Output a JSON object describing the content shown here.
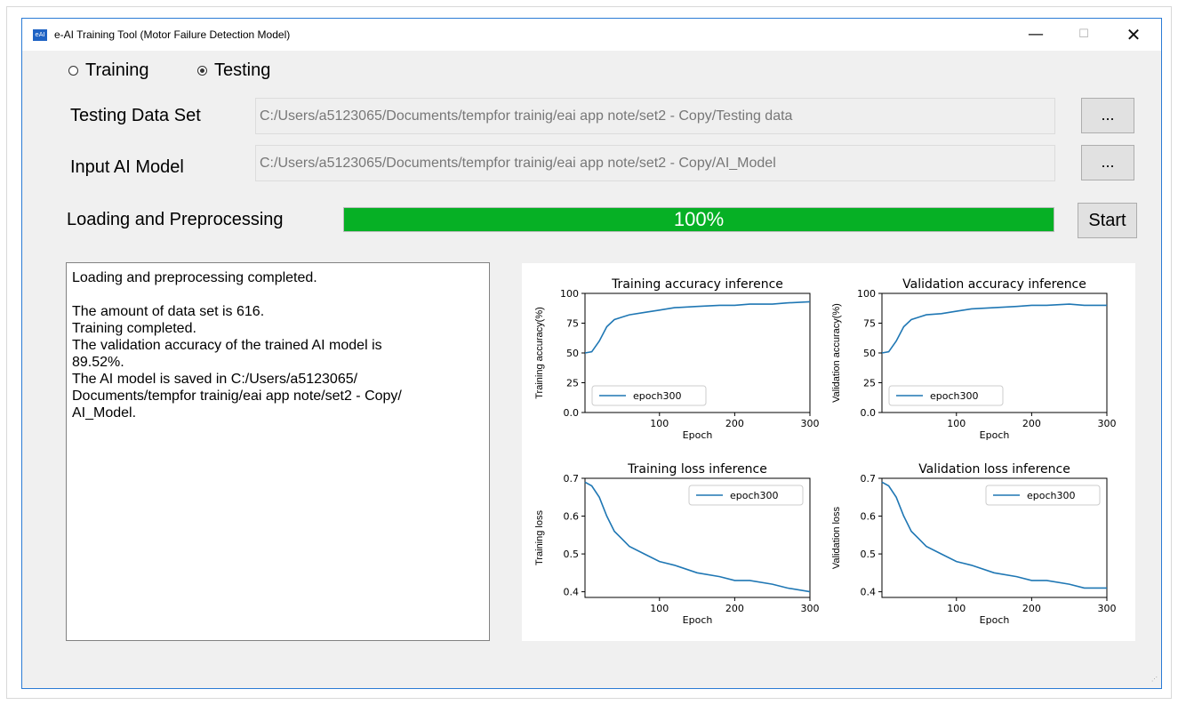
{
  "window": {
    "title": "e-AI Training Tool (Motor Failure Detection Model)",
    "icon_text": "eAI",
    "controls": {
      "minimize": "—",
      "maximize": "☐",
      "close": "✕"
    }
  },
  "mode": {
    "options": [
      {
        "label": "Training",
        "selected": false
      },
      {
        "label": "Testing",
        "selected": true
      }
    ]
  },
  "form": {
    "testing_data_label": "Testing Data Set",
    "testing_data_path": "C:/Users/a5123065/Documents/tempfor trainig/eai app note/set2 - Copy/Testing data",
    "input_model_label": "Input AI Model",
    "input_model_path": "C:/Users/a5123065/Documents/tempfor trainig/eai app note/set2 - Copy/AI_Model",
    "browse_label": "...",
    "progress_label": "Loading and Preprocessing",
    "progress_text": "100%",
    "progress_value": 1.0,
    "start_label": "Start"
  },
  "log": {
    "lines": [
      "Loading and preprocessing completed.",
      "",
      "The amount of data set is 616.",
      "Training completed.",
      "The validation accuracy of the trained AI model is",
      "89.52%.",
      "The AI model is saved in C:/Users/a5123065/",
      "Documents/tempfor trainig/eai app note/set2 - Copy/",
      "AI_Model."
    ]
  },
  "colors": {
    "progress_fill": "#06b025",
    "series": "#1f77b4"
  },
  "chart_data": [
    {
      "type": "line",
      "title": "Training accuracy inference",
      "xlabel": "Epoch",
      "ylabel": "Training accuracy(%)",
      "xlim": [
        1,
        300
      ],
      "ylim": [
        0,
        100
      ],
      "xticks": [
        100,
        200,
        300
      ],
      "yticks": [
        0,
        25,
        50,
        75,
        100
      ],
      "legend": "lower left",
      "series": [
        {
          "name": "epoch300",
          "x": [
            1,
            10,
            20,
            30,
            40,
            50,
            60,
            80,
            100,
            120,
            150,
            180,
            200,
            220,
            250,
            270,
            300
          ],
          "y": [
            50,
            51,
            60,
            72,
            78,
            80,
            82,
            84,
            86,
            88,
            89,
            90,
            90,
            91,
            91,
            92,
            93
          ]
        }
      ]
    },
    {
      "type": "line",
      "title": "Validation accuracy inference",
      "xlabel": "Epoch",
      "ylabel": "Validation accuracy(%)",
      "xlim": [
        1,
        300
      ],
      "ylim": [
        0,
        100
      ],
      "xticks": [
        100,
        200,
        300
      ],
      "yticks": [
        0,
        25,
        50,
        75,
        100
      ],
      "legend": "lower left",
      "series": [
        {
          "name": "epoch300",
          "x": [
            1,
            10,
            20,
            30,
            40,
            50,
            60,
            80,
            100,
            120,
            150,
            180,
            200,
            220,
            250,
            270,
            300
          ],
          "y": [
            50,
            51,
            60,
            72,
            78,
            80,
            82,
            83,
            85,
            87,
            88,
            89,
            90,
            90,
            91,
            90,
            90
          ]
        }
      ]
    },
    {
      "type": "line",
      "title": "Training loss inference",
      "xlabel": "Epoch",
      "ylabel": "Training loss",
      "xlim": [
        1,
        300
      ],
      "ylim": [
        0.385,
        0.7
      ],
      "xticks": [
        100,
        200,
        300
      ],
      "yticks": [
        0.4,
        0.5,
        0.6,
        0.7
      ],
      "legend": "upper right",
      "series": [
        {
          "name": "epoch300",
          "x": [
            1,
            10,
            20,
            30,
            40,
            50,
            60,
            80,
            100,
            120,
            150,
            180,
            200,
            220,
            250,
            270,
            300
          ],
          "y": [
            0.69,
            0.68,
            0.65,
            0.6,
            0.56,
            0.54,
            0.52,
            0.5,
            0.48,
            0.47,
            0.45,
            0.44,
            0.43,
            0.43,
            0.42,
            0.41,
            0.4
          ]
        }
      ]
    },
    {
      "type": "line",
      "title": "Validation loss inference",
      "xlabel": "Epoch",
      "ylabel": "Validation loss",
      "xlim": [
        1,
        300
      ],
      "ylim": [
        0.385,
        0.7
      ],
      "xticks": [
        100,
        200,
        300
      ],
      "yticks": [
        0.4,
        0.5,
        0.6,
        0.7
      ],
      "legend": "upper right",
      "series": [
        {
          "name": "epoch300",
          "x": [
            1,
            10,
            20,
            30,
            40,
            50,
            60,
            80,
            100,
            120,
            150,
            180,
            200,
            220,
            250,
            270,
            300
          ],
          "y": [
            0.69,
            0.68,
            0.65,
            0.6,
            0.56,
            0.54,
            0.52,
            0.5,
            0.48,
            0.47,
            0.45,
            0.44,
            0.43,
            0.43,
            0.42,
            0.41,
            0.41
          ]
        }
      ]
    }
  ]
}
